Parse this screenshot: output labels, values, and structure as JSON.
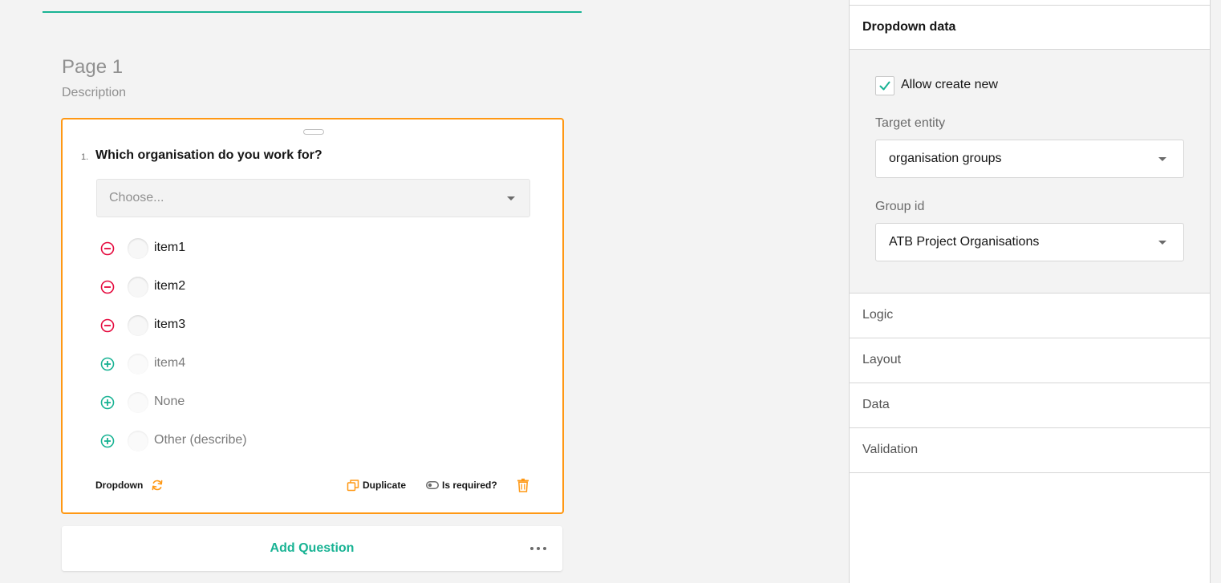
{
  "page": {
    "title": "Page 1",
    "description": "Description"
  },
  "question": {
    "number": "1.",
    "title": "Which organisation do you work for?",
    "dropdown_placeholder": "Choose...",
    "choices": [
      {
        "label": "item1",
        "action": "remove"
      },
      {
        "label": "item2",
        "action": "remove"
      },
      {
        "label": "item3",
        "action": "remove"
      },
      {
        "label": "item4",
        "action": "add"
      },
      {
        "label": "None",
        "action": "add"
      },
      {
        "label": "Other (describe)",
        "action": "add"
      }
    ],
    "footer": {
      "type_label": "Dropdown",
      "duplicate_label": "Duplicate",
      "required_label": "Is required?"
    }
  },
  "add_question": {
    "label": "Add Question"
  },
  "properties": {
    "active_section": "Dropdown data",
    "allow_create_new": {
      "label": "Allow create new",
      "checked": true
    },
    "target_entity": {
      "label": "Target entity",
      "value": "organisation groups"
    },
    "group_id": {
      "label": "Group id",
      "value": "ATB Project Organisations"
    },
    "sections": [
      "Logic",
      "Layout",
      "Data",
      "Validation"
    ]
  },
  "colors": {
    "accent": "#19b394",
    "selected_border": "#ff9814",
    "remove": "#e50a3e"
  },
  "icons": {
    "remove": "minus-circle-icon",
    "add": "plus-circle-icon",
    "refresh": "refresh-icon",
    "duplicate": "duplicate-icon",
    "toggle": "toggle-icon",
    "delete": "trash-icon",
    "more": "more-dots-icon",
    "checkmark": "checkmark-icon"
  }
}
